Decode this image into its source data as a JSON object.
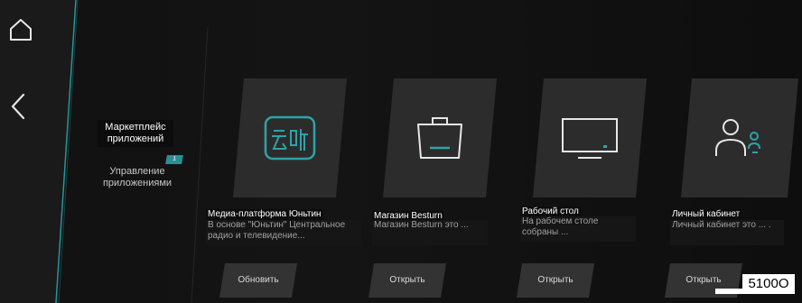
{
  "sidebar": {
    "icons": {
      "home": "home-icon",
      "back": "back-arrow-icon"
    },
    "items": [
      {
        "label": "Маркетплейс приложений"
      },
      {
        "label": "Управление приложениями",
        "badge": "1"
      }
    ]
  },
  "apps": [
    {
      "icon": "yunting-logo-icon",
      "title": "Медиа-платформа Юньтин",
      "desc": "В основе \"Юньтин\" Центральное радио и телевидение...",
      "button": "Обновить"
    },
    {
      "icon": "shopping-bag-icon",
      "title": "Магазин Besturn",
      "desc": "Магазин Besturn это ...",
      "button": "Открыть"
    },
    {
      "icon": "monitor-icon",
      "title": "Рабочий стол",
      "desc": "На рабочем столе собраны ...",
      "button": "Открыть"
    },
    {
      "icon": "user-profile-icon",
      "title": "Личный кабинет",
      "desc": "Личный кабинет это ... .",
      "button": "Открыть"
    }
  ],
  "overlay_text": "5100O",
  "colors": {
    "accent": "#2ea3a8",
    "tile": "#2c2c2c",
    "background": "#111111"
  }
}
